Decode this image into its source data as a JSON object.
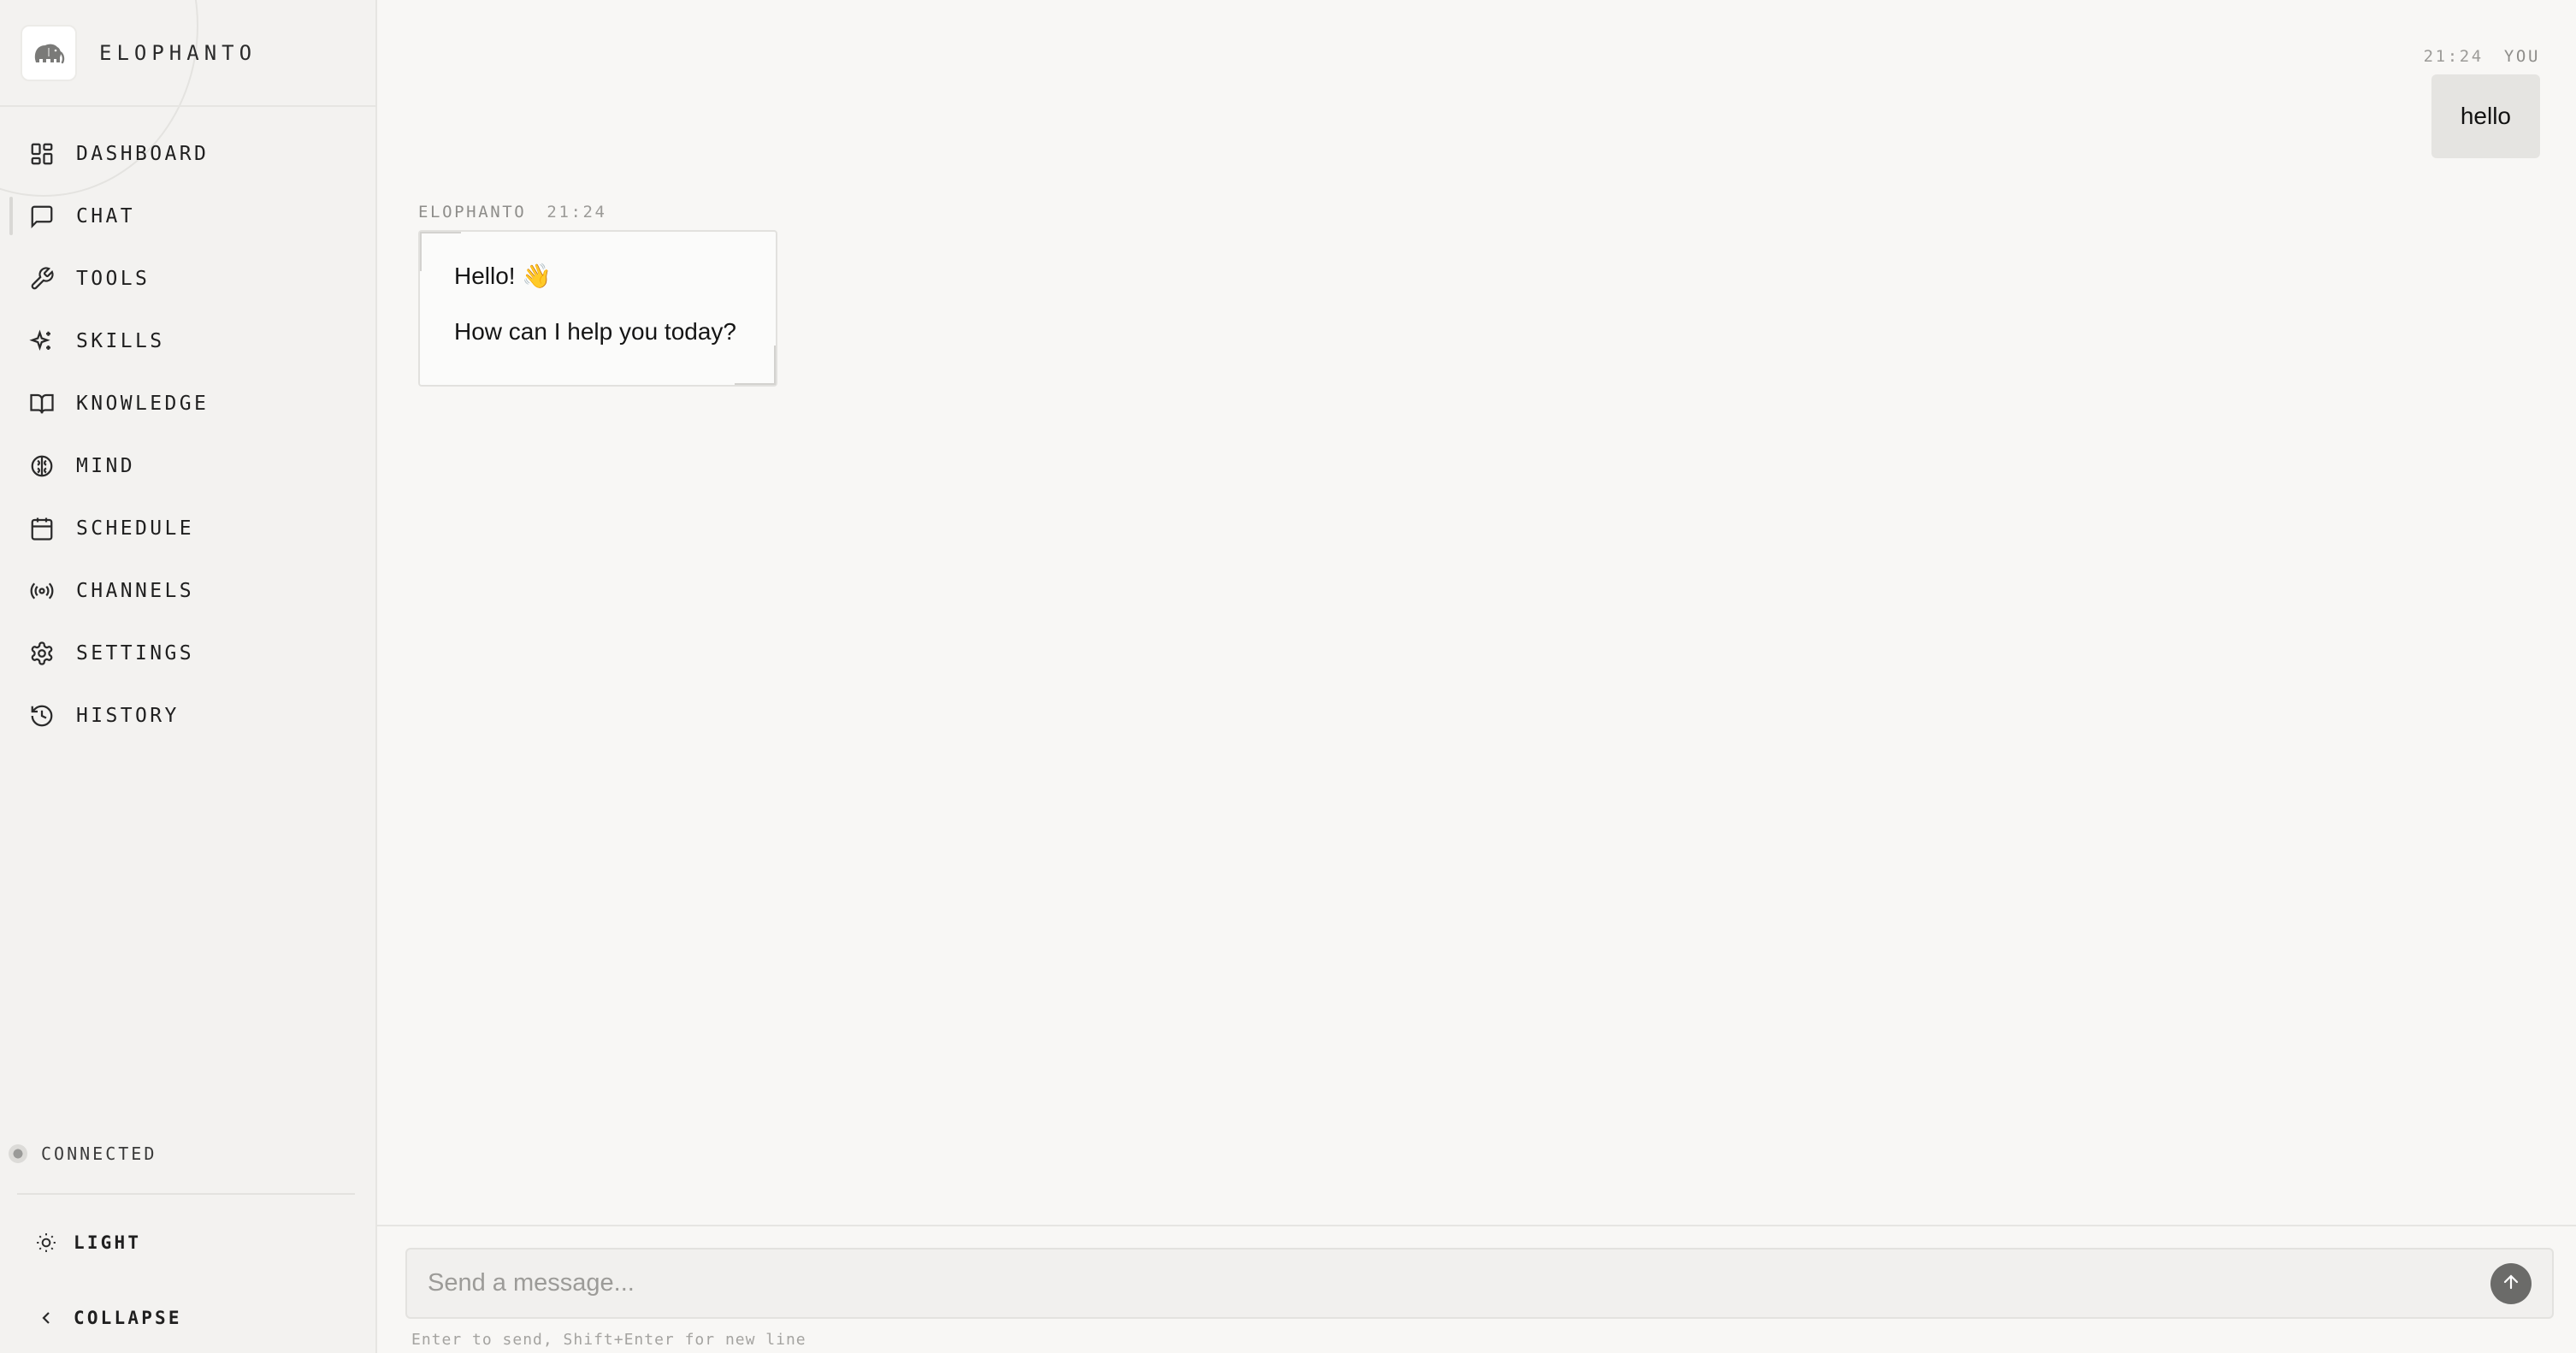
{
  "app": {
    "name": "ELOPHANTO"
  },
  "sidebar": {
    "items": [
      {
        "label": "DASHBOARD",
        "icon": "dashboard-grid-icon",
        "active": false
      },
      {
        "label": "CHAT",
        "icon": "chat-bubble-icon",
        "active": true
      },
      {
        "label": "TOOLS",
        "icon": "wrench-icon",
        "active": false
      },
      {
        "label": "SKILLS",
        "icon": "sparkles-icon",
        "active": false
      },
      {
        "label": "KNOWLEDGE",
        "icon": "book-icon",
        "active": false
      },
      {
        "label": "MIND",
        "icon": "brain-icon",
        "active": false
      },
      {
        "label": "SCHEDULE",
        "icon": "calendar-icon",
        "active": false
      },
      {
        "label": "CHANNELS",
        "icon": "broadcast-icon",
        "active": false
      },
      {
        "label": "SETTINGS",
        "icon": "gear-icon",
        "active": false
      },
      {
        "label": "HISTORY",
        "icon": "history-icon",
        "active": false
      }
    ],
    "status": "CONNECTED",
    "theme_label": "LIGHT",
    "collapse_label": "COLLAPSE"
  },
  "chat": {
    "user_message": {
      "time": "21:24",
      "sender": "YOU",
      "text": "hello"
    },
    "bot_message": {
      "sender": "ELOPHANTO",
      "time": "21:24",
      "lines": [
        "Hello! 👋",
        "How can I help you today?"
      ]
    },
    "composer": {
      "placeholder": "Send a message...",
      "value": "",
      "hint": "Enter to send, Shift+Enter for new line"
    }
  },
  "colors": {
    "background": "#f8f7f5",
    "sidebar": "#f3f2f0",
    "user_bubble": "#e5e4e1",
    "send_button": "#6b6b69"
  }
}
